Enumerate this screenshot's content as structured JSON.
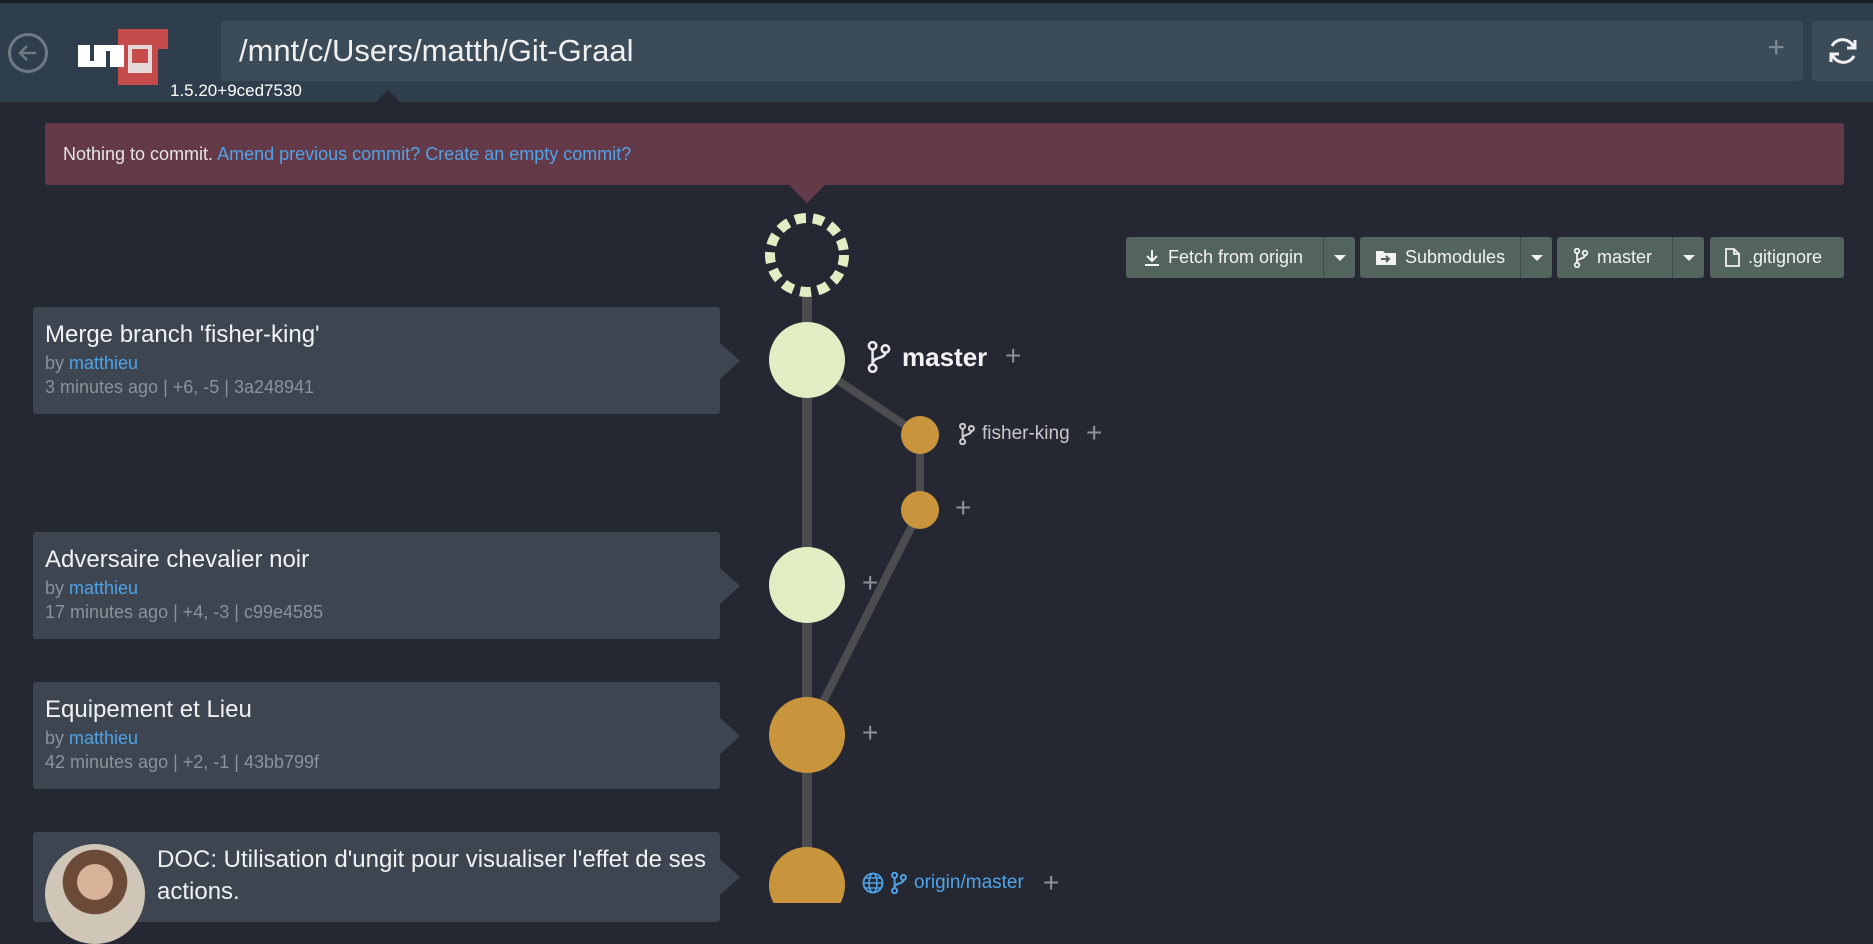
{
  "header": {
    "back_icon": "arrow-left-circle-icon",
    "logo_text": "ungit",
    "version": "1.5.20+9ced7530",
    "path": "/mnt/c/Users/matth/Git-Graal",
    "add_icon": "plus-icon",
    "refresh_icon": "refresh-icon"
  },
  "alert": {
    "text": "Nothing to commit.",
    "amend_link": "Amend previous commit?",
    "empty_link": "Create an empty commit?"
  },
  "toolbar": {
    "fetch_label": "Fetch from origin",
    "submodules_label": "Submodules",
    "branch_label": "master",
    "gitignore_label": ".gitignore"
  },
  "commits": [
    {
      "title": "Merge branch 'fisher-king'",
      "by": "by",
      "author": "matthieu",
      "meta": "3 minutes ago | +6, -5 | 3a248941"
    },
    {
      "title": "Adversaire chevalier noir",
      "by": "by",
      "author": "matthieu",
      "meta": "17 minutes ago | +4, -3 | c99e4585"
    },
    {
      "title": "Equipement et Lieu",
      "by": "by",
      "author": "matthieu",
      "meta": "42 minutes ago | +2, -1 | 43bb799f"
    },
    {
      "title": "DOC: Utilisation d'ungit pour visualiser l'effet de ses actions."
    }
  ],
  "branches": {
    "master": "master",
    "fisher_king": "fisher-king",
    "origin_master": "origin/master"
  },
  "colors": {
    "background": "#252833",
    "header": "#2e3e4c",
    "alert": "#653a48",
    "link": "#4fa3e8",
    "node_main": "#e1edc2",
    "node_branch": "#c9953c",
    "edge": "#4a4c4e"
  }
}
